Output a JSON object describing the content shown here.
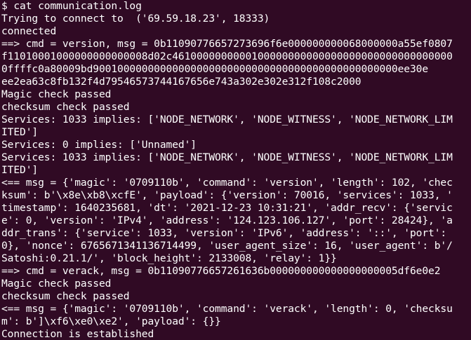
{
  "terminal": {
    "lines": [
      "$ cat communication.log",
      "Trying to connect to  ('69.59.18.23', 18333)",
      "connected",
      "==> cmd = version, msg = 0b11090776657273696f6e000000000068000000a55ef0807",
      "f11010001000000000000008d02c4610000000000100000000000000000000000000000000",
      "0ffffc0a80009bd90010000000000000000000000000000000000000000000000ee30e",
      "ee2ea63c8fb132f4d79546573744167656e743a302e302e312f108c2000",
      "Magic check passed",
      "checksum check passed",
      "Services: 1033 implies: ['NODE_NETWORK', 'NODE_WITNESS', 'NODE_NETWORK_LIM",
      "ITED']",
      "Services: 0 implies: ['Unnamed']",
      "Services: 1033 implies: ['NODE_NETWORK', 'NODE_WITNESS', 'NODE_NETWORK_LIM",
      "ITED']",
      "<== msg = {'magic': '0709110b', 'command': 'version', 'length': 102, 'chec",
      "ksum': b'\\x8e\\xb8\\xcfE', 'payload': {'version': 70016, 'services': 1033, '",
      "timestamp': 1640235681, 'dt': '2021-12-23 10:31:21', 'addr_recv': {'servic",
      "e': 0, 'version': 'IPv4', 'address': '124.123.106.127', 'port': 28424}, 'a",
      "ddr_trans': {'service': 1033, 'version': 'IPv6', 'address': '::', 'port':",
      "0}, 'nonce': 6765671341136714499, 'user_agent_size': 16, 'user_agent': b'/",
      "Satoshi:0.21.1/', 'block_height': 2133008, 'relay': 1}}",
      "==> cmd = verack, msg = 0b11090776657261636b000000000000000000005df6e0e2",
      "Magic check passed",
      "checksum check passed",
      "<== msg = {'magic': '0709110b', 'command': 'verack', 'length': 0, 'checksu",
      "m': b']\\xf6\\xe0\\xe2', 'payload': {}}",
      "Connection is established"
    ]
  },
  "colors": {
    "background": "#300a24",
    "text": "#ffffff"
  }
}
